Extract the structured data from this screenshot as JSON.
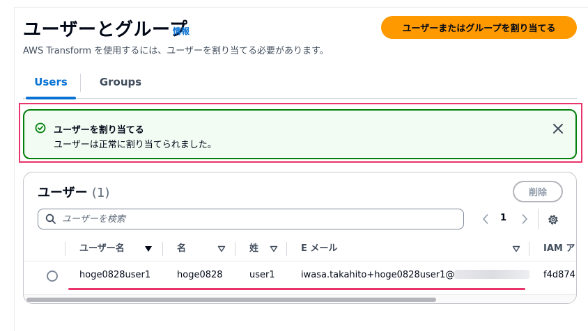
{
  "header": {
    "title": "ユーザーとグループ",
    "info_label": "情報",
    "subtitle": "AWS Transform を使用するには、ユーザーを割り当てる必要があります。",
    "assign_button_label": "ユーザーまたはグループを割り当てる"
  },
  "tabs": [
    {
      "label": "Users",
      "active": true
    },
    {
      "label": "Groups",
      "active": false
    }
  ],
  "flash": {
    "status": "success",
    "title": "ユーザーを割り当てる",
    "message": "ユーザーは正常に割り当てられました。",
    "icons": {
      "status": "check-circle-icon",
      "dismiss": "close-icon"
    }
  },
  "users_table": {
    "title": "ユーザー",
    "count": "(1)",
    "delete_label": "削除",
    "search_placeholder": "ユーザーを検索",
    "pagination": {
      "current_page": "1"
    },
    "columns": [
      {
        "label": "ユーザー名",
        "sort": "descending"
      },
      {
        "label": "名",
        "sort": "none"
      },
      {
        "label": "姓",
        "sort": "none"
      },
      {
        "label": "E メール",
        "sort": "none"
      },
      {
        "label": "IAM ア"
      }
    ],
    "rows": [
      {
        "username": "hoge0828user1",
        "first_name": "hoge0828",
        "last_name": "user1",
        "email": "iwasa.takahito+hoge0828user1@",
        "iam_id": "f4d874"
      }
    ]
  },
  "colors": {
    "primary_button": "#ff9900",
    "link": "#0972d3",
    "success_border": "#037f0c",
    "success_background": "#f2fcf3",
    "annotation": "#e8336b"
  }
}
